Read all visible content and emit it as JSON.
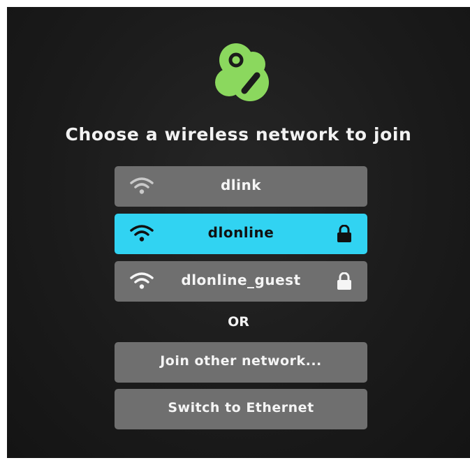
{
  "screen": {
    "heading": "Choose a wireless network to join",
    "logo_icon": "boxee-logo-icon",
    "accent_color": "#31d3f2",
    "logo_color": "#8bd85e"
  },
  "networks": [
    {
      "name": "dlink",
      "secured": false,
      "selected": false,
      "icon": "wifi-icon"
    },
    {
      "name": "dlonline",
      "secured": true,
      "selected": true,
      "icon": "wifi-icon"
    },
    {
      "name": "dlonline_guest",
      "secured": true,
      "selected": false,
      "icon": "wifi-icon"
    }
  ],
  "separator": "OR",
  "actions": {
    "join_other": "Join other network...",
    "switch_ethernet": "Switch to Ethernet"
  }
}
